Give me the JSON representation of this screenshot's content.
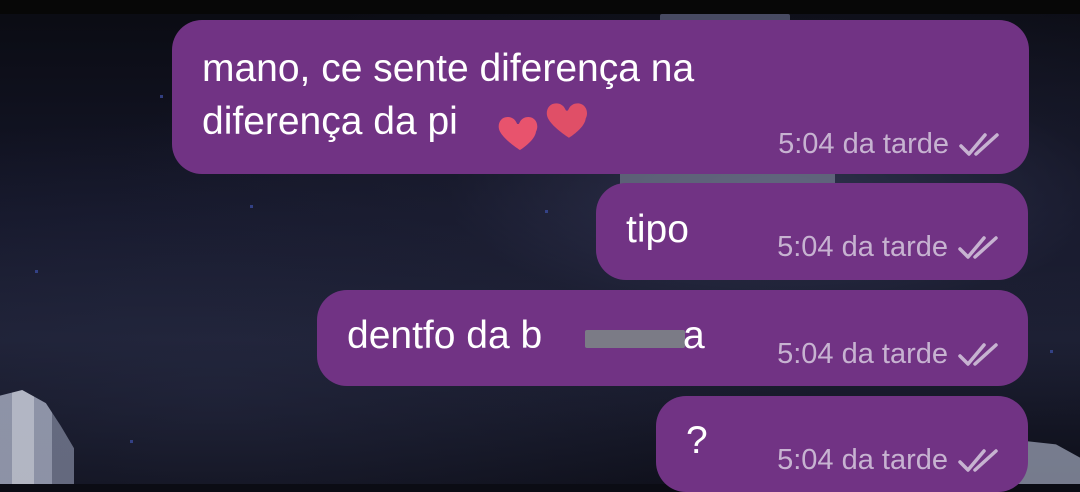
{
  "messages": [
    {
      "text": "mano, ce sente diferença na",
      "text2": "diferença da pi",
      "time": "5:04 da tarde",
      "status_icon": "double-check-icon"
    },
    {
      "text": "tipo",
      "time": "5:04 da tarde",
      "status_icon": "double-check-icon"
    },
    {
      "text": "dentfo da b",
      "text_tail": "a",
      "time": "5:04 da tarde",
      "status_icon": "double-check-icon"
    },
    {
      "text": "?",
      "time": "5:04 da tarde",
      "status_icon": "double-check-icon"
    }
  ],
  "colors": {
    "bubble": "#713384",
    "meta_text": "#c7b3d1",
    "heart": "#e8536d",
    "redaction": "#7b7b86"
  },
  "decorations": [
    "heart-sticker",
    "redaction-bar"
  ]
}
